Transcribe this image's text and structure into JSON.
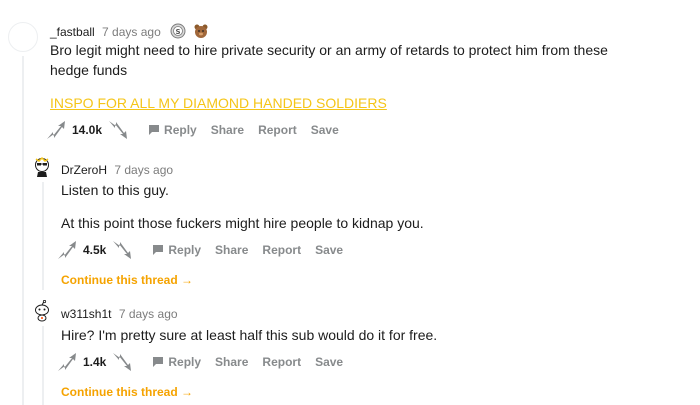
{
  "comments": [
    {
      "username": "_fastball",
      "time": "7 days ago",
      "body": "Bro legit might need to hire private security or an army of retards to protect him from these",
      "body2": "hedge funds",
      "link": "INSPO FOR ALL MY DIAMOND HANDED SOLDIERS",
      "score": "14.0k"
    },
    {
      "username": "DrZeroH",
      "time": "7 days ago",
      "body": "Listen to this guy.",
      "body2": "At this point those fuckers might hire people to kidnap you.",
      "score": "4.5k",
      "continue": "Continue this thread"
    },
    {
      "username": "w311sh1t",
      "time": "7 days ago",
      "body": "Hire? I'm pretty sure at least half this sub would do it for free.",
      "score": "1.4k",
      "continue": "Continue this thread"
    }
  ],
  "actions": {
    "reply": "Reply",
    "share": "Share",
    "report": "Report",
    "save": "Save"
  },
  "colors": {
    "link": "#f5c518",
    "continue": "#f5a300",
    "muted": "#878a8c",
    "thread_line": "#edeff1"
  }
}
